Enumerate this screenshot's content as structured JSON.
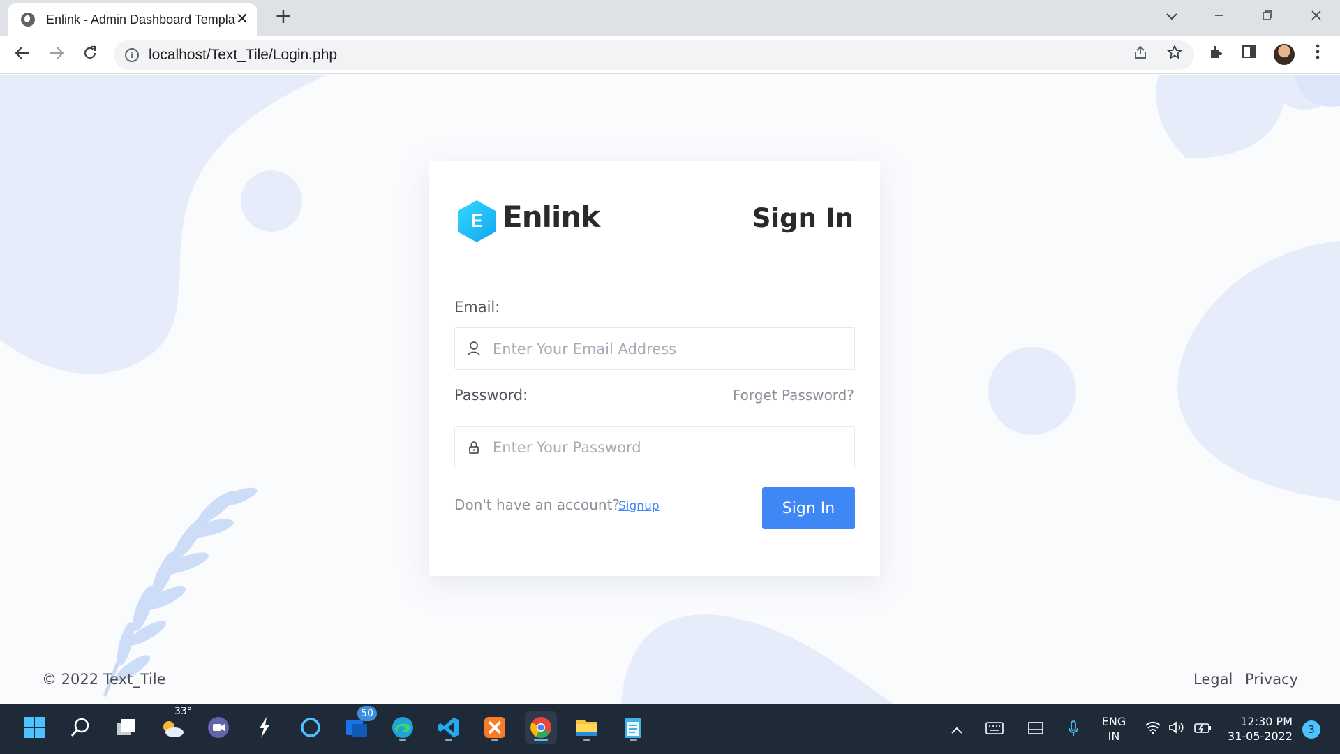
{
  "browser": {
    "tab_title": "Enlink - Admin Dashboard Template",
    "tab_close_label": "✕",
    "new_tab_label": "+",
    "url": "localhost/Text_Tile/Login.php",
    "icons": [
      "back-icon",
      "forward-icon",
      "reload-icon",
      "site-info-icon",
      "share-icon",
      "bookmark-star-icon",
      "extensions-icon",
      "side-panel-icon",
      "profile-avatar",
      "menu-icon",
      "tab-search-icon",
      "minimize-icon",
      "restore-icon",
      "close-window-icon"
    ]
  },
  "login": {
    "brand_name": "Enlink",
    "brand_letter": "E",
    "title": "Sign In",
    "email_label": "Email:",
    "email_placeholder": "Enter Your Email Address",
    "password_label": "Password:",
    "password_placeholder": "Enter Your Password",
    "forgot_password": "Forget Password?",
    "no_account_text": "Don't have an account?",
    "signup_link": "Signup",
    "submit_label": "Sign In"
  },
  "footer": {
    "copyright": "© 2022 Text_Tile",
    "links": [
      "Legal",
      "Privacy"
    ]
  },
  "taskbar": {
    "weather_temp": "33°",
    "mail_badge": "50",
    "language_line1": "ENG",
    "language_line2": "IN",
    "time": "12:30 PM",
    "date": "31-05-2022",
    "notification_count": "3"
  },
  "colors": {
    "accent": "#3f87f5",
    "logo": "#1fb8f8",
    "decoration": "#e6ecfa",
    "taskbar": "#1f2a38"
  }
}
